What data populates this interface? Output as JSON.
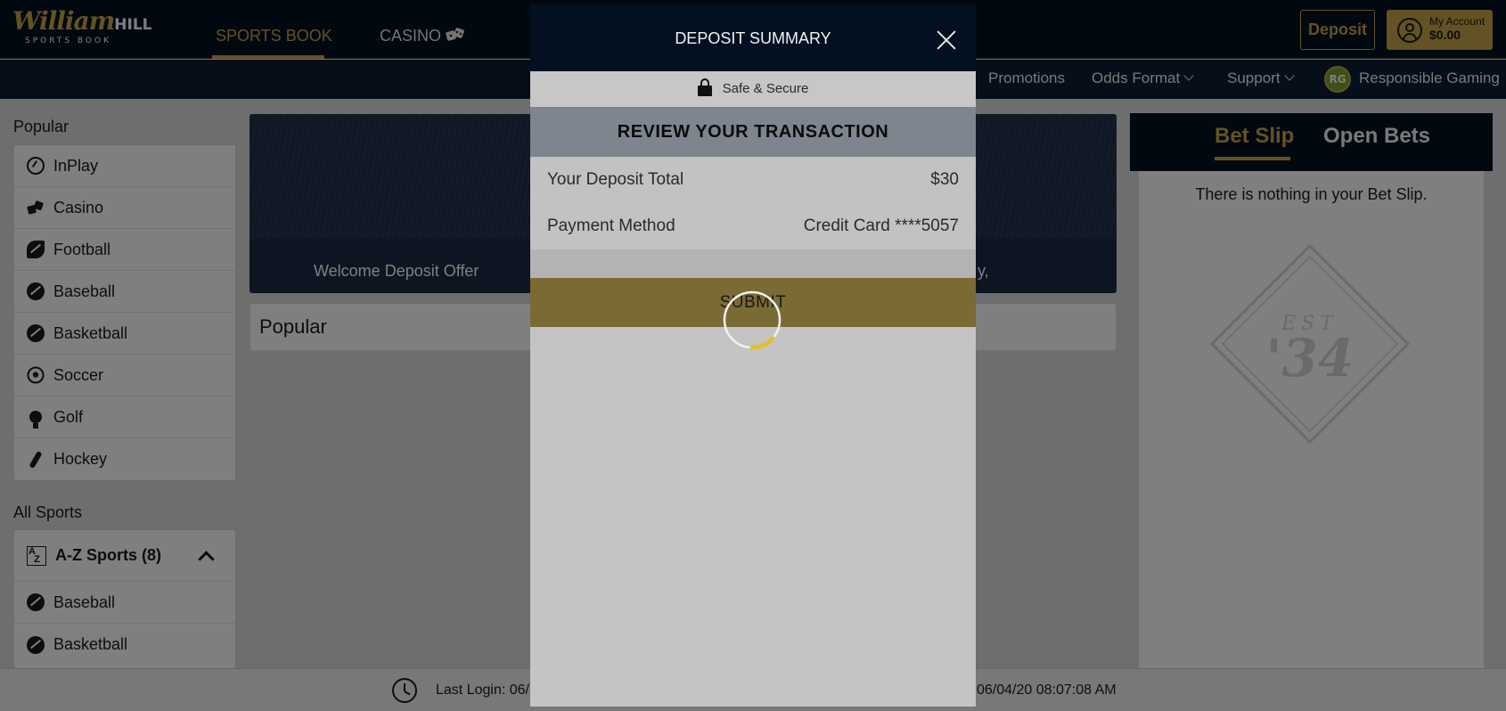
{
  "header": {
    "logo_main": "William",
    "logo_hill": "HILL",
    "logo_sub": "SPORTS BOOK",
    "nav": [
      {
        "label": "SPORTS BOOK",
        "active": true
      },
      {
        "label": "CASINO",
        "active": false
      }
    ],
    "deposit_label": "Deposit",
    "account_label": "My Account",
    "account_balance": "$0.00"
  },
  "subnav": {
    "items": [
      "Promotions",
      "Odds Format",
      "Support",
      "Responsible Gaming"
    ],
    "rg_badge": "RG"
  },
  "sidebar": {
    "popular_heading": "Popular",
    "popular_items": [
      {
        "label": "InPlay",
        "icon": "inplay-icon"
      },
      {
        "label": "Casino",
        "icon": "dice-icon"
      },
      {
        "label": "Football",
        "icon": "football-icon"
      },
      {
        "label": "Baseball",
        "icon": "baseball-icon"
      },
      {
        "label": "Basketball",
        "icon": "basketball-icon"
      },
      {
        "label": "Soccer",
        "icon": "soccer-icon"
      },
      {
        "label": "Golf",
        "icon": "golf-icon"
      },
      {
        "label": "Hockey",
        "icon": "hockey-icon"
      }
    ],
    "all_sports_heading": "All Sports",
    "az_label": "A-Z Sports (8)",
    "az_items": [
      {
        "label": "Baseball",
        "icon": "baseball-icon"
      },
      {
        "label": "Basketball",
        "icon": "basketball-icon"
      }
    ]
  },
  "main": {
    "banner_left_caption": "Welcome Deposit Offer",
    "banner_right_caption": "y,",
    "popular_title": "Popular"
  },
  "betslip": {
    "tabs": [
      {
        "label": "Bet Slip",
        "active": true
      },
      {
        "label": "Open Bets",
        "active": false
      }
    ],
    "empty_message": "There is nothing in your Bet Slip.",
    "est_text": "EST",
    "est_year": "'34"
  },
  "footer": {
    "last_login": "Last Login: 06/",
    "current_time": "06/04/20 08:07:08 AM"
  },
  "modal": {
    "title": "DEPOSIT SUMMARY",
    "secure_label": "Safe & Secure",
    "review_heading": "REVIEW YOUR TRANSACTION",
    "rows": [
      {
        "label": "Your Deposit Total",
        "value": "$30"
      },
      {
        "label": "Payment Method",
        "value": "Credit Card ****5057"
      }
    ],
    "submit_label": "SUBMIT"
  },
  "colors": {
    "brand_gold": "#c6a546",
    "navy": "#031021",
    "subnav_navy": "#0c1d33"
  }
}
